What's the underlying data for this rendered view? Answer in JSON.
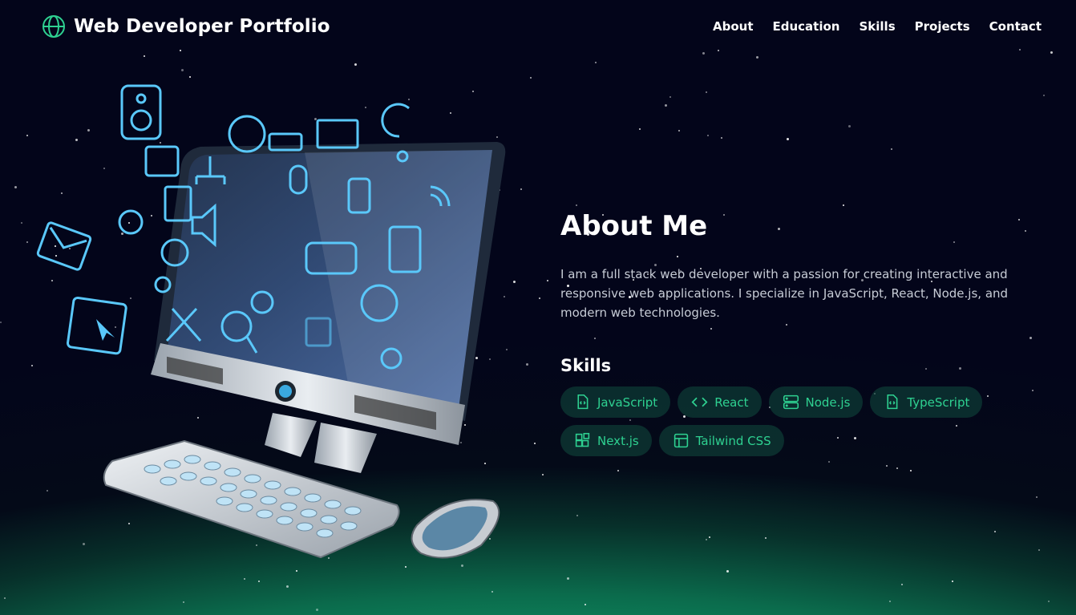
{
  "header": {
    "title": "Web Developer Portfolio",
    "logo_icon": "globe-icon",
    "nav": [
      {
        "label": "About"
      },
      {
        "label": "Education"
      },
      {
        "label": "Skills"
      },
      {
        "label": "Projects"
      },
      {
        "label": "Contact"
      }
    ]
  },
  "about": {
    "heading": "About Me",
    "description": "I am a full stack web developer with a passion for creating interactive and responsive web applications. I specialize in JavaScript, React, Node.js, and modern web technologies."
  },
  "skills": {
    "heading": "Skills",
    "items": [
      {
        "label": "JavaScript",
        "icon": "file-code-icon"
      },
      {
        "label": "React",
        "icon": "code-brackets-icon"
      },
      {
        "label": "Node.js",
        "icon": "server-icon"
      },
      {
        "label": "TypeScript",
        "icon": "file-code-icon"
      },
      {
        "label": "Next.js",
        "icon": "grid-blocks-icon"
      },
      {
        "label": "Tailwind CSS",
        "icon": "layout-icon"
      }
    ]
  },
  "colors": {
    "accent": "#2ed191",
    "background_top": "#03051a",
    "background_bottom": "#10c07f"
  }
}
